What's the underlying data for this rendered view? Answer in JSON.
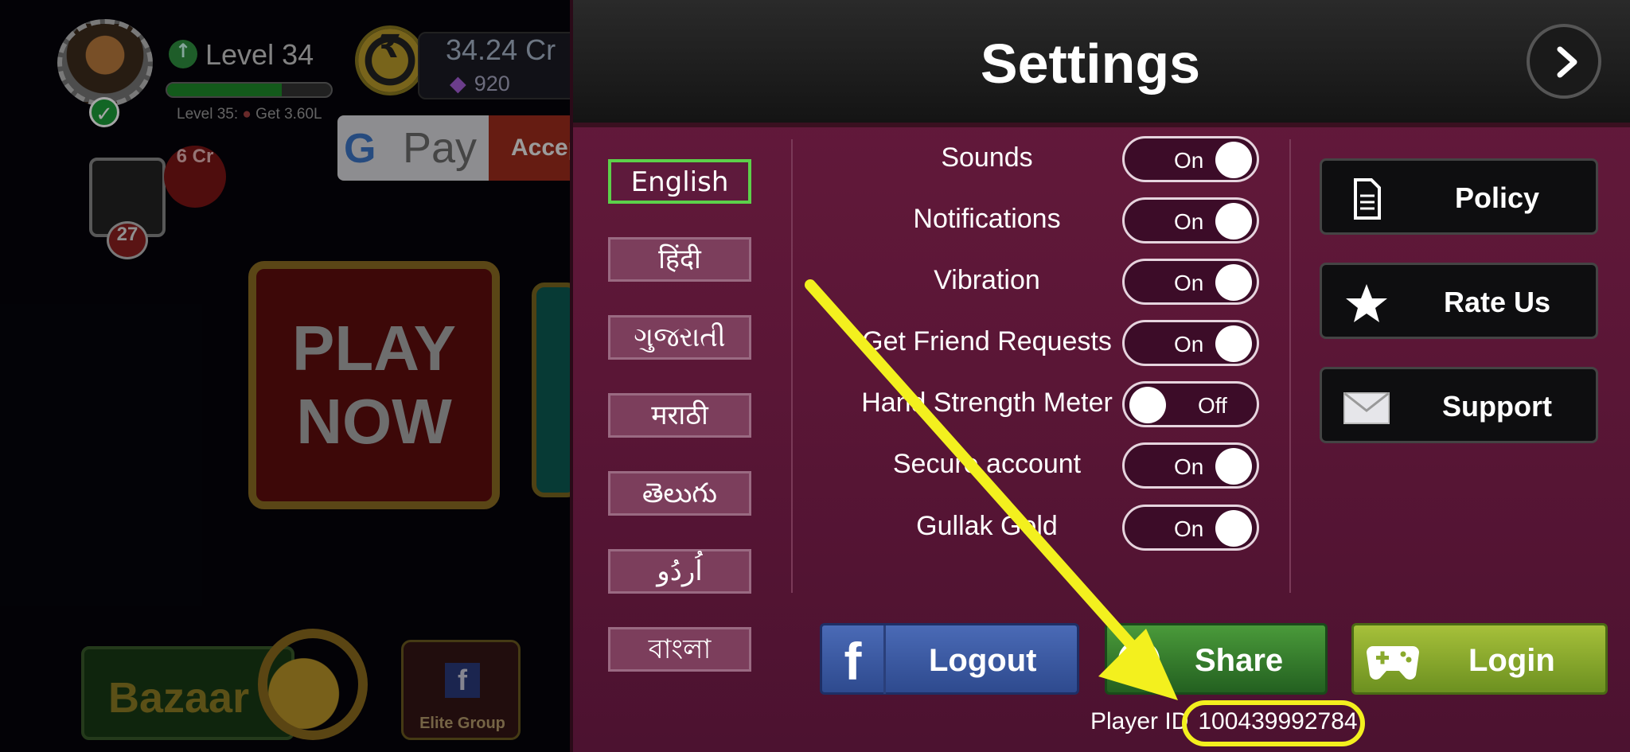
{
  "lobby": {
    "level_label": "Level 34",
    "level_progress": 0.7,
    "level_next": "Level 35:",
    "level_next_reward": "Get 3.60L",
    "balance": "34.24 Cr",
    "gems": "920",
    "gpay_g": "G",
    "gpay_pay": "Pay",
    "gpay_accept": "Accept",
    "tables_badge": "6 Cr",
    "players_count": "27",
    "play_now_line1": "PLAY",
    "play_now_line2": "NOW",
    "bazaar_label": "Bazaar",
    "elite_label": "Elite Group",
    "rupee_symbol": "₹"
  },
  "settings": {
    "title": "Settings",
    "languages": [
      {
        "label": "English",
        "active": true
      },
      {
        "label": "हिंदी",
        "active": false
      },
      {
        "label": "ગુજરાતી",
        "active": false
      },
      {
        "label": "मराठी",
        "active": false
      },
      {
        "label": "తెలుగు",
        "active": false
      },
      {
        "label": "اُردُو",
        "active": false
      },
      {
        "label": "বাংলা",
        "active": false
      }
    ],
    "options": [
      {
        "label": "Sounds",
        "state": "On"
      },
      {
        "label": "Notifications",
        "state": "On"
      },
      {
        "label": "Vibration",
        "state": "On"
      },
      {
        "label": "Get Friend Requests",
        "state": "On"
      },
      {
        "label": "Hand Strength Meter",
        "state": "Off"
      },
      {
        "label": "Secure account",
        "state": "On"
      },
      {
        "label": "Gullak Gold",
        "state": "On"
      }
    ],
    "side_buttons": {
      "policy": "Policy",
      "rate_us": "Rate Us",
      "support": "Support"
    },
    "bottom_buttons": {
      "logout": "Logout",
      "share": "Share",
      "login": "Login"
    },
    "player_id_label": "Player ID",
    "player_id_value": "100439992784"
  },
  "annotation_color": "#f3f01e",
  "colors": {
    "panel": "#5a1636",
    "toggle_on_track": "#3c0c28",
    "active_language_border": "#5cd04a"
  }
}
